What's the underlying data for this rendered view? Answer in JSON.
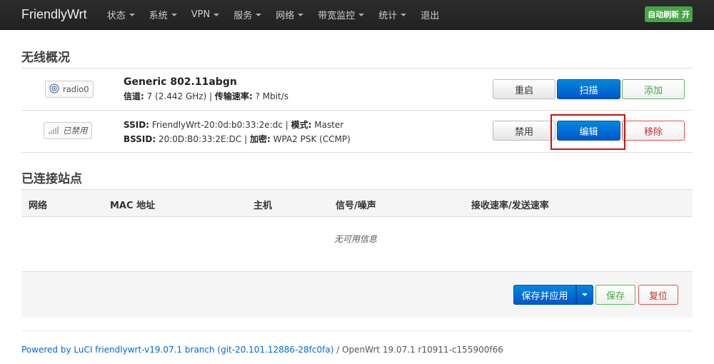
{
  "nav": {
    "brand": "FriendlyWrt",
    "menus": [
      "状态",
      "系统",
      "VPN",
      "服务",
      "网络",
      "带宽监控",
      "统计"
    ],
    "logout": "退出",
    "autorefresh": "自动刷新 开"
  },
  "wireless": {
    "title": "无线概况",
    "device": {
      "badge": "radio0",
      "name": "Generic 802.11abgn",
      "channel_label": "信道:",
      "channel_value": "7 (2.442 GHz)",
      "rate_label": "传输速率:",
      "rate_value": "? Mbit/s",
      "buttons": {
        "restart": "重启",
        "scan": "扫描",
        "add": "添加"
      }
    },
    "network": {
      "badge": "已禁用",
      "ssid_label": "SSID:",
      "ssid_value": "FriendlyWrt-20:0d:b0:33:2e:dc",
      "mode_label": "模式:",
      "mode_value": "Master",
      "bssid_label": "BSSID:",
      "bssid_value": "20:0D:B0:33:2E:DC",
      "enc_label": "加密:",
      "enc_value": "WPA2 PSK (CCMP)",
      "buttons": {
        "disable": "禁用",
        "edit": "编辑",
        "remove": "移除"
      }
    }
  },
  "stations": {
    "title": "已连接站点",
    "columns": [
      "网络",
      "MAC 地址",
      "主机",
      "信号/噪声",
      "接收速率/发送速率"
    ],
    "empty": "无可用信息"
  },
  "actions": {
    "save_apply": "保存并应用",
    "save": "保存",
    "reset": "复位"
  },
  "footer": {
    "link": "Powered by LuCI friendlywrt-v19.07.1 branch (git-20.101.12886-28fc0fa)",
    "rest": " / OpenWrt 19.07.1 r10911-c155900f66"
  }
}
